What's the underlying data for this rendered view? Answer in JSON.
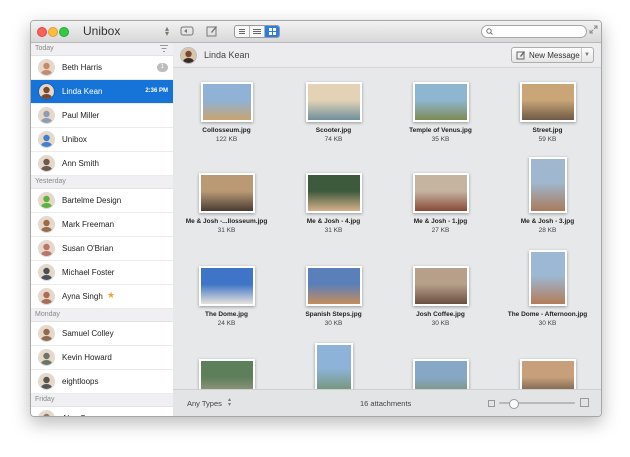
{
  "app": {
    "title": "Unibox"
  },
  "sidebar": {
    "sections": [
      {
        "label": "Today",
        "items": [
          {
            "name": "Beth Harris",
            "badge": "1",
            "color": "#c48b6a"
          },
          {
            "name": "Linda Kean",
            "time": "2:36 PM",
            "selected": true,
            "color": "#7a4a2f"
          },
          {
            "name": "Paul Miller",
            "color": "#8b9cb3"
          },
          {
            "name": "Unibox",
            "color": "#3f7fd1"
          },
          {
            "name": "Ann Smith",
            "color": "#6b5a4d"
          }
        ]
      },
      {
        "label": "Yesterday",
        "items": [
          {
            "name": "Bartelme Design",
            "color": "#5ab33b"
          },
          {
            "name": "Mark Freeman",
            "color": "#9a6b4a"
          },
          {
            "name": "Susan O'Brian",
            "color": "#b9746b"
          },
          {
            "name": "Michael Foster",
            "color": "#4b4f57"
          },
          {
            "name": "Ayna Singh",
            "star": true,
            "color": "#a86d58"
          }
        ]
      },
      {
        "label": "Monday",
        "items": [
          {
            "name": "Samuel Colley",
            "color": "#8d6a50"
          },
          {
            "name": "Kevin Howard",
            "color": "#6c7466"
          },
          {
            "name": "eightloops",
            "color": "#555555"
          }
        ]
      },
      {
        "label": "Friday",
        "items": [
          {
            "name": "Alan Spencer",
            "color": "#8a7b6b"
          }
        ]
      }
    ]
  },
  "conversation": {
    "name": "Linda Kean",
    "new_message": "New Message"
  },
  "attachments": [
    {
      "name": "Collosseum.jpg",
      "size": "122 KB",
      "colors": [
        "#8fb2d6",
        "#c8a470"
      ]
    },
    {
      "name": "Scooter.jpg",
      "size": "74 KB",
      "colors": [
        "#e3d2b6",
        "#6e8f9c"
      ]
    },
    {
      "name": "Temple of Venus.jpg",
      "size": "35 KB",
      "colors": [
        "#8fb6d0",
        "#7d8a55"
      ]
    },
    {
      "name": "Street.jpg",
      "size": "59 KB",
      "colors": [
        "#c9a577",
        "#6e5a45"
      ]
    },
    {
      "name": "Me & Josh -...llosseum.jpg",
      "size": "31 KB",
      "colors": [
        "#b99a75",
        "#4a3c33"
      ]
    },
    {
      "name": "Me & Josh - 4.jpg",
      "size": "31 KB",
      "colors": [
        "#3e5a3d",
        "#d6b18b"
      ]
    },
    {
      "name": "Me & Josh - 1.jpg",
      "size": "27 KB",
      "colors": [
        "#c4b4a0",
        "#8a4a38"
      ]
    },
    {
      "name": "Me & Josh - 3.jpg",
      "size": "28 KB",
      "colors": [
        "#9fb8cf",
        "#a97a5c"
      ]
    },
    {
      "name": "The Dome.jpg",
      "size": "24 KB",
      "colors": [
        "#3f74c6",
        "#e6e2dc"
      ]
    },
    {
      "name": "Spanish Steps.jpg",
      "size": "30 KB",
      "colors": [
        "#5b7fb8",
        "#c58d5c"
      ]
    },
    {
      "name": "Josh Coffee.jpg",
      "size": "30 KB",
      "colors": [
        "#b6a08a",
        "#6a4e3f"
      ]
    },
    {
      "name": "The Dome - Afternoon.jpg",
      "size": "30 KB",
      "colors": [
        "#9cb8d4",
        "#b47c5a"
      ]
    },
    {
      "name": "",
      "size": "",
      "colors": [
        "#5d7f5a",
        "#a89e8c"
      ]
    },
    {
      "name": "",
      "size": "",
      "colors": [
        "#8db3d8",
        "#6f8d5e"
      ]
    },
    {
      "name": "",
      "size": "",
      "colors": [
        "#86a8c6",
        "#7b8f6a"
      ]
    },
    {
      "name": "",
      "size": "",
      "colors": [
        "#c7a07b",
        "#5b4a3e"
      ]
    }
  ],
  "footer": {
    "types_label": "Any Types",
    "count": "16 attachments",
    "zoom_level": 0.18
  },
  "accent": "#1674d8"
}
